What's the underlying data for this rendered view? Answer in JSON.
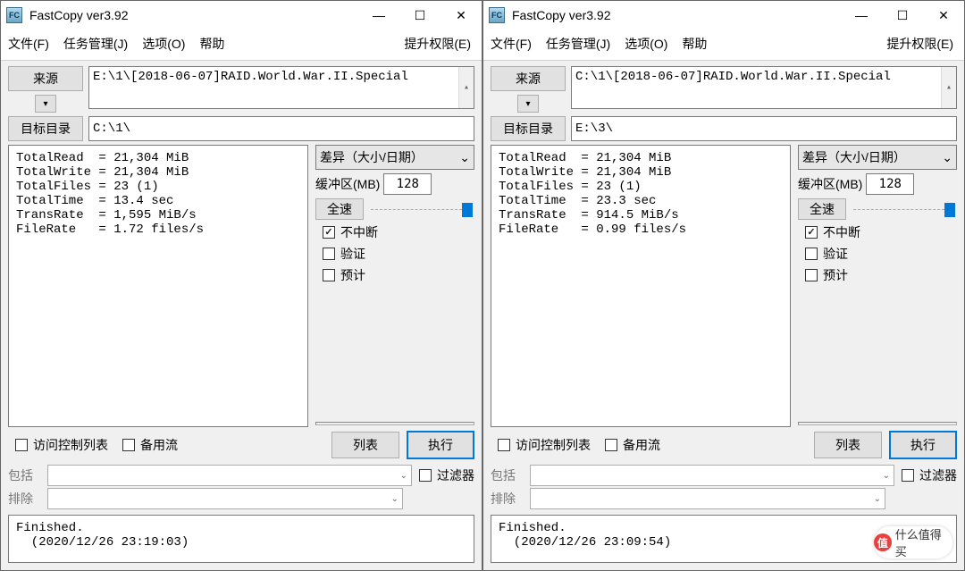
{
  "windows": [
    {
      "title": "FastCopy ver3.92",
      "menu": {
        "file": "文件(F)",
        "jobs": "任务管理(J)",
        "options": "选项(O)",
        "help": "帮助",
        "elevate": "提升权限(E)"
      },
      "source": {
        "button": "来源",
        "value": "E:\\1\\[2018-06-07]RAID.World.War.II.Special"
      },
      "dest": {
        "button": "目标目录",
        "value": "C:\\1\\"
      },
      "stats": "TotalRead  = 21,304 MiB\nTotalWrite = 21,304 MiB\nTotalFiles = 23 (1)\nTotalTime  = 13.4 sec\nTransRate  = 1,595 MiB/s\nFileRate   = 1.72 files/s",
      "mode": "差异（大小/日期）",
      "buffer": {
        "label": "缓冲区(MB)",
        "value": "128"
      },
      "speed": {
        "label": "全速"
      },
      "checks": {
        "nonstop": "不中断",
        "verify": "验证",
        "estimate": "预计"
      },
      "exec": {
        "acl": "访问控制列表",
        "altstream": "备用流",
        "list": "列表",
        "execute": "执行"
      },
      "filter": {
        "include": "包括",
        "exclude": "排除",
        "label": "过滤器"
      },
      "status": "Finished.\n  (2020/12/26 23:19:03)"
    },
    {
      "title": "FastCopy ver3.92",
      "menu": {
        "file": "文件(F)",
        "jobs": "任务管理(J)",
        "options": "选项(O)",
        "help": "帮助",
        "elevate": "提升权限(E)"
      },
      "source": {
        "button": "来源",
        "value": "C:\\1\\[2018-06-07]RAID.World.War.II.Special"
      },
      "dest": {
        "button": "目标目录",
        "value": "E:\\3\\"
      },
      "stats": "TotalRead  = 21,304 MiB\nTotalWrite = 21,304 MiB\nTotalFiles = 23 (1)\nTotalTime  = 23.3 sec\nTransRate  = 914.5 MiB/s\nFileRate   = 0.99 files/s",
      "mode": "差异（大小/日期）",
      "buffer": {
        "label": "缓冲区(MB)",
        "value": "128"
      },
      "speed": {
        "label": "全速"
      },
      "checks": {
        "nonstop": "不中断",
        "verify": "验证",
        "estimate": "预计"
      },
      "exec": {
        "acl": "访问控制列表",
        "altstream": "备用流",
        "list": "列表",
        "execute": "执行"
      },
      "filter": {
        "include": "包括",
        "exclude": "排除",
        "label": "过滤器"
      },
      "status": "Finished.\n  (2020/12/26 23:09:54)"
    }
  ],
  "watermark": "什么值得买"
}
